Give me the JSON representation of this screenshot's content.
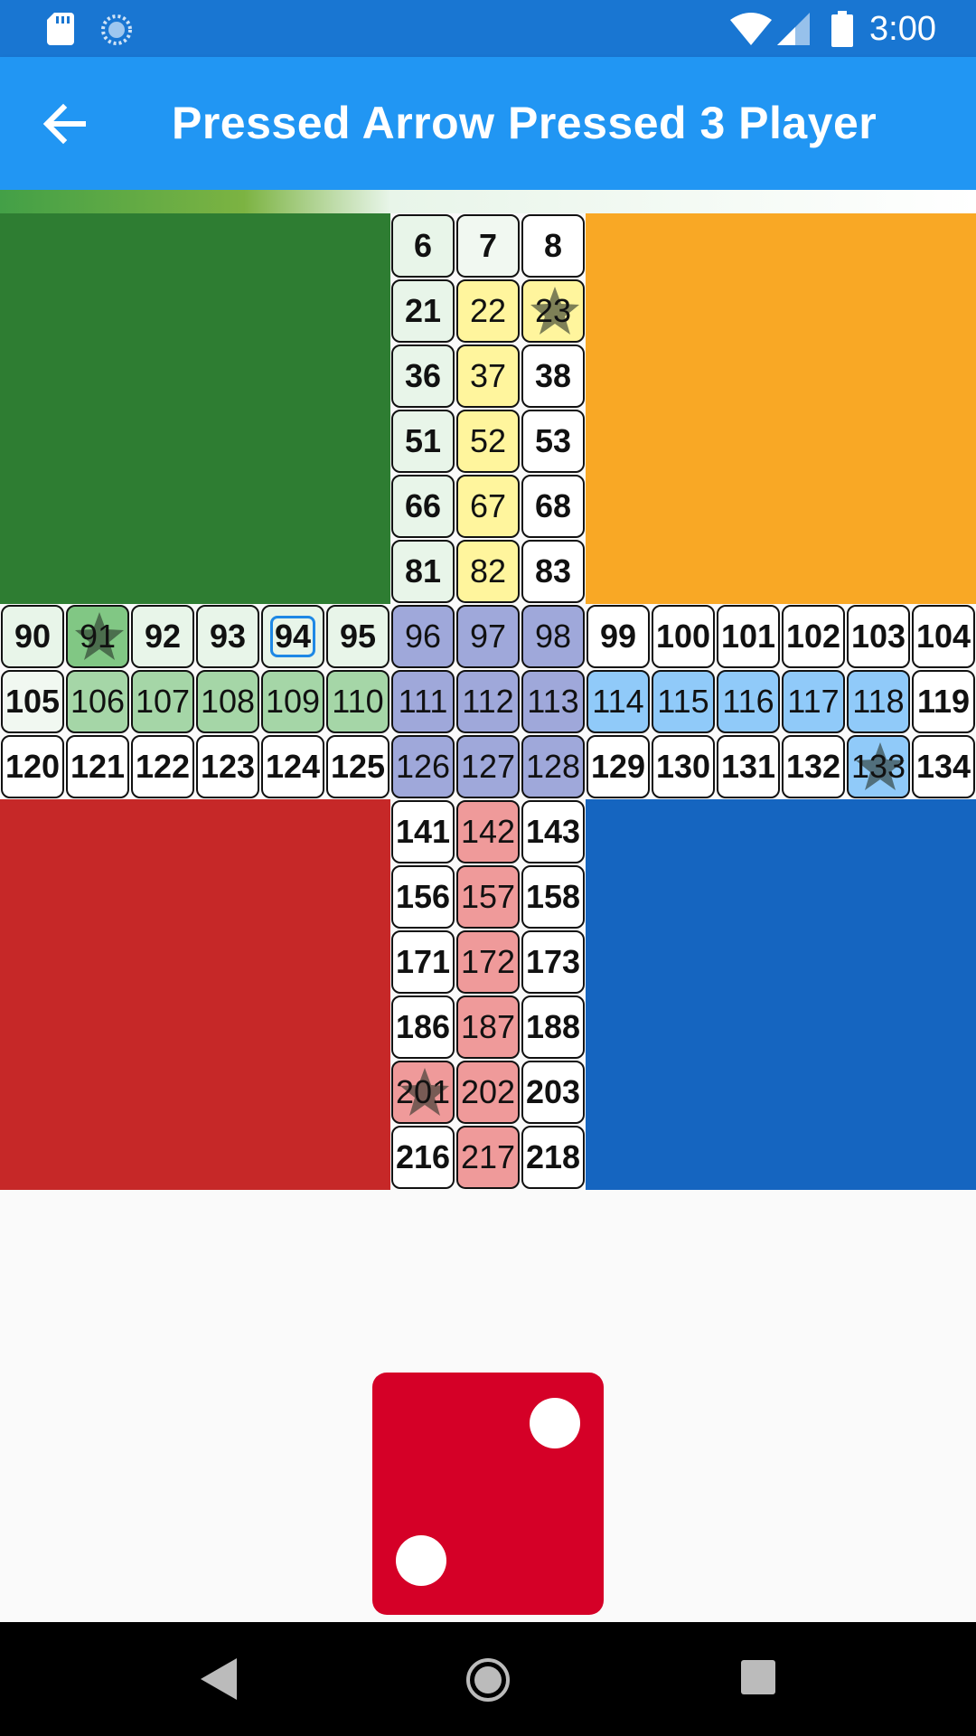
{
  "status_bar": {
    "time": "3:00",
    "icons": [
      "sd-card-icon",
      "sync-icon",
      "wifi-icon",
      "signal-icon",
      "battery-icon"
    ]
  },
  "app_bar": {
    "title": "Pressed Arrow  Pressed 3 Player",
    "back_icon": "arrow-left-icon"
  },
  "colors": {
    "status_bar": "#1976d2",
    "app_bar": "#2196f3",
    "green_home": "#2e7d32",
    "yellow_home": "#f9a825",
    "red_home": "#c62828",
    "blue_home": "#1565c0",
    "dice": "#d50027"
  },
  "board": {
    "top_arm": [
      [
        "6",
        "7",
        "8"
      ],
      [
        "21",
        "22",
        "23"
      ],
      [
        "36",
        "37",
        "38"
      ],
      [
        "51",
        "52",
        "53"
      ],
      [
        "66",
        "67",
        "68"
      ],
      [
        "81",
        "82",
        "83"
      ]
    ],
    "middle_rows": [
      [
        "90",
        "91",
        "92",
        "93",
        "94",
        "95",
        "96",
        "97",
        "98",
        "99",
        "100",
        "101",
        "102",
        "103",
        "104"
      ],
      [
        "105",
        "106",
        "107",
        "108",
        "109",
        "110",
        "111",
        "112",
        "113",
        "114",
        "115",
        "116",
        "117",
        "118",
        "119"
      ],
      [
        "120",
        "121",
        "122",
        "123",
        "124",
        "125",
        "126",
        "127",
        "128",
        "129",
        "130",
        "131",
        "132",
        "133",
        "134"
      ]
    ],
    "bottom_arm": [
      [
        "141",
        "142",
        "143"
      ],
      [
        "156",
        "157",
        "158"
      ],
      [
        "171",
        "172",
        "173"
      ],
      [
        "186",
        "187",
        "188"
      ],
      [
        "201",
        "202",
        "203"
      ],
      [
        "216",
        "217",
        "218"
      ]
    ],
    "star_cells": [
      "23",
      "91",
      "133",
      "201"
    ],
    "selected_cell": "94"
  },
  "dice": {
    "value": 2
  },
  "nav_bar": {
    "icons": [
      "nav-back-icon",
      "nav-home-icon",
      "nav-recents-icon"
    ]
  }
}
